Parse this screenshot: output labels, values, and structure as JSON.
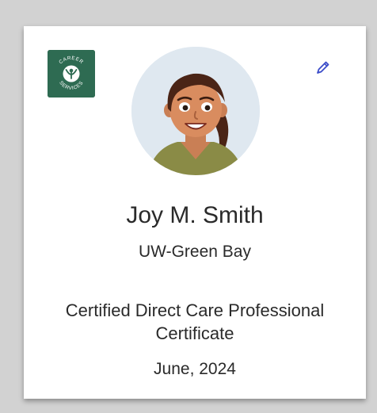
{
  "card": {
    "badge": {
      "line1": "CAREER",
      "line2": "SERVICES"
    },
    "icons": {
      "badge": "career-services-logo",
      "edit": "pencil-icon",
      "avatar": "person-illustration"
    },
    "name": "Joy M. Smith",
    "school": "UW-Green Bay",
    "credential": "Certified Direct Care Professional Certificate",
    "date": "June, 2024"
  },
  "colors": {
    "badge_green": "#2e6b52",
    "edit_blue": "#3b4cc9",
    "text": "#2a2a2a"
  }
}
